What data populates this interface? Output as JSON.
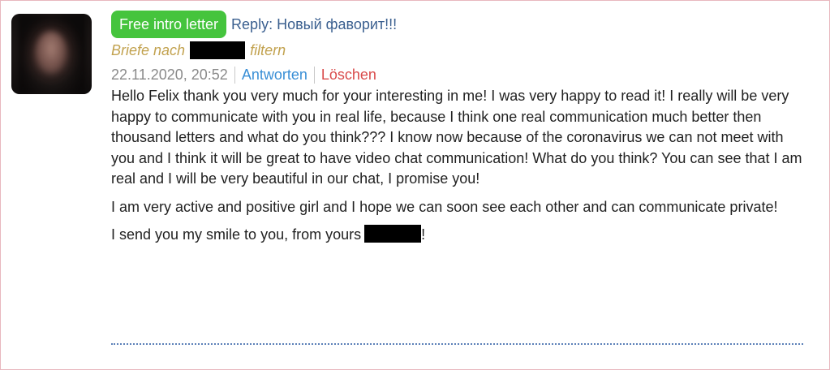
{
  "message": {
    "badge": "Free intro letter",
    "subject": "Reply: Новый фаворит!!!",
    "filter_prefix": "Briefe nach",
    "filter_suffix": "filtern",
    "date": "22.11.2020, 20:52",
    "reply_label": "Antworten",
    "delete_label": "Löschen",
    "paragraphs": [
      "Hello Felix thank you very much for your interesting in me! I was very happy to read it! I really will be very happy to communicate with you in real life, because I think one real communication much better then thousand letters and what do you think??? I know now because of the coronavirus we can not meet with you and I think it will be great to have video chat communication! What do you think? You can see that I am real and I will be very beautiful in our chat, I promise you!",
      "I am very active and positive girl and I hope we can soon see each other and can communicate private!"
    ],
    "closing_prefix": "I send you my smile to you, from yours",
    "closing_suffix": "!"
  },
  "colors": {
    "badge": "#45c43d",
    "subject": "#3a5f8f",
    "filter": "#c2a24f",
    "reply_link": "#3a8fd6",
    "delete_link": "#d94b4b",
    "divider": "#5b80b8",
    "frame_border": "#e8b8bf"
  }
}
